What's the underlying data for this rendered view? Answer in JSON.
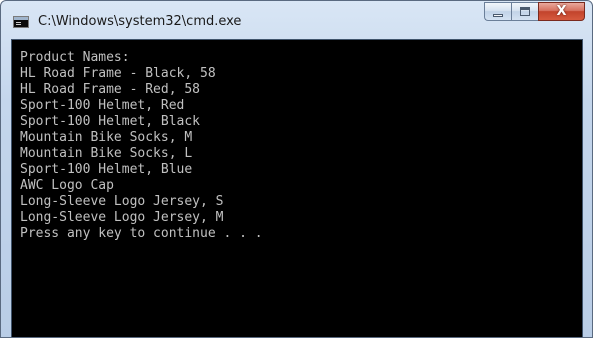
{
  "window": {
    "title": "C:\\Windows\\system32\\cmd.exe",
    "icon": "cmd-icon",
    "controls": {
      "minimize": "minimize-icon",
      "maximize": "maximize-icon",
      "close": "X"
    }
  },
  "console": {
    "lines": [
      "Product Names:",
      "HL Road Frame - Black, 58",
      "HL Road Frame - Red, 58",
      "Sport-100 Helmet, Red",
      "Sport-100 Helmet, Black",
      "Mountain Bike Socks, M",
      "Mountain Bike Socks, L",
      "Sport-100 Helmet, Blue",
      "AWC Logo Cap",
      "Long-Sleeve Logo Jersey, S",
      "Long-Sleeve Logo Jersey, M",
      "Press any key to continue . . ."
    ]
  },
  "colors": {
    "console_background": "#000000",
    "console_text": "#c0c0c0",
    "close_button": "#c2432c"
  }
}
